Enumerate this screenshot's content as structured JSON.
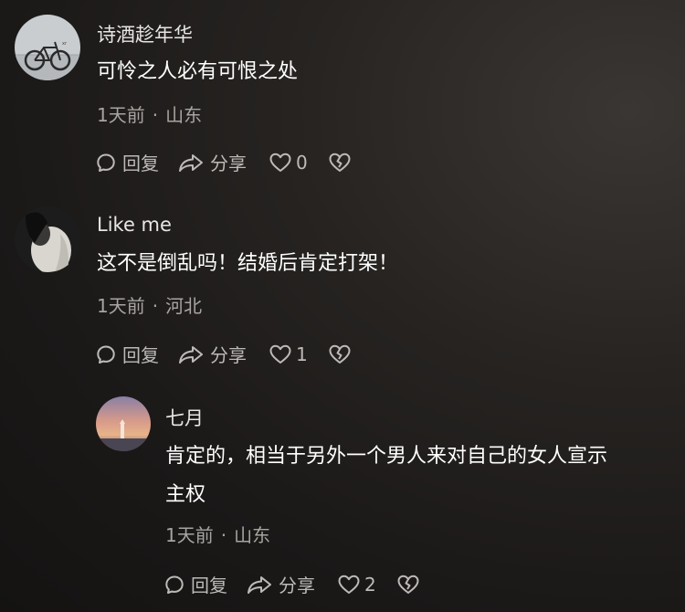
{
  "comments": [
    {
      "username": "诗酒趁年华",
      "content": "可怜之人必有可恨之处",
      "time": "1天前",
      "location": "山东",
      "reply_label": "回复",
      "share_label": "分享",
      "likes": "0"
    },
    {
      "username": "Like me",
      "content": "这不是倒乱吗！结婚后肯定打架！",
      "time": "1天前",
      "location": "河北",
      "reply_label": "回复",
      "share_label": "分享",
      "likes": "1"
    },
    {
      "username": "七月",
      "content_line1": "肯定的，相当于另外一个男人来对自己的女人宣示",
      "content_line2": "主权",
      "time": "1天前",
      "location": "山东",
      "reply_label": "回复",
      "share_label": "分享",
      "likes": "2"
    }
  ],
  "separator": "·",
  "icons": [
    "reply-icon",
    "share-icon",
    "like-heart-icon",
    "dislike-broken-heart-icon"
  ]
}
